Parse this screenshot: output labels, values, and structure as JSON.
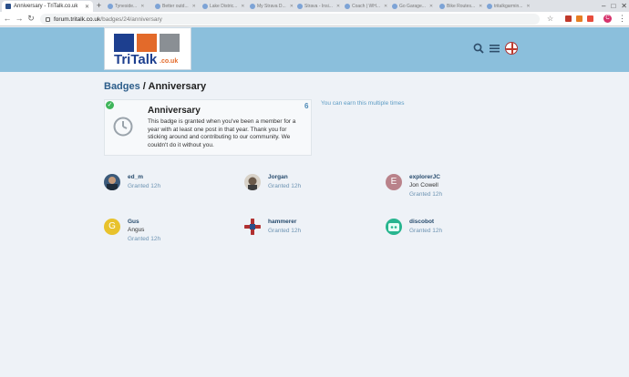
{
  "browser": {
    "active_tab": "Anniversary - TriTalk.co.uk",
    "inactive_tabs": [
      "Tyneside...",
      "Better outd...",
      "Lake Distric...",
      "My Strava D...",
      "Strava - Insi...",
      "Coach | WH...",
      "Go Garage...",
      "Bike Routes...",
      "tritalkgarmin..."
    ],
    "url_host": "forum.tritalk.co.uk",
    "url_path": "/badges/24/anniversary",
    "profile_initial": "C"
  },
  "site": {
    "logo_text": "TriTalk",
    "logo_domain": ".co.uk"
  },
  "breadcrumb": {
    "parent": "Badges",
    "separator": " / ",
    "current": "Anniversary"
  },
  "badge": {
    "title": "Anniversary",
    "description": "This badge is granted when you've been a member for a year with at least one post in that year. Thank you for sticking around and contributing to our community. We couldn't do it without you.",
    "count": "6",
    "multiple_note": "You can earn this multiple times"
  },
  "grantees": [
    {
      "username": "ed_m",
      "name": "",
      "granted": "Granted 12h",
      "avatar_letter": "",
      "avatar_color": "#3b5a7a"
    },
    {
      "username": "Jorgan",
      "name": "",
      "granted": "Granted 12h",
      "avatar_letter": "",
      "avatar_color": "#6b5a4a"
    },
    {
      "username": "explorerJC",
      "name": "Jon Cowell",
      "granted": "Granted 12h",
      "avatar_letter": "E",
      "avatar_color": "#b9828a"
    },
    {
      "username": "Gus",
      "name": "Angus",
      "granted": "Granted 12h",
      "avatar_letter": "G",
      "avatar_color": "#e8c22c"
    },
    {
      "username": "hammerer",
      "name": "",
      "granted": "Granted 12h",
      "avatar_letter": "",
      "avatar_color": "#b03030"
    },
    {
      "username": "discobot",
      "name": "",
      "granted": "Granted 12h",
      "avatar_letter": "",
      "avatar_color": "#27b58f"
    }
  ],
  "colors": {
    "header_bg": "#8bbfdc",
    "page_bg": "#eef2f7",
    "link": "#2c5d8a",
    "granted": "#6e94b3"
  }
}
